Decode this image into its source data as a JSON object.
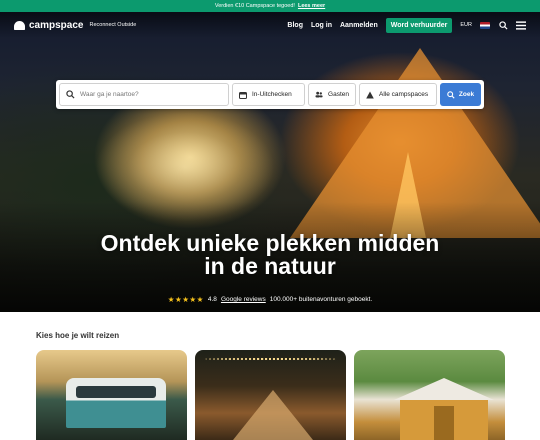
{
  "promo": {
    "text": "Verdien €10 Campspace tegoed!",
    "link": "Lees meer"
  },
  "nav": {
    "brand": "campspace",
    "tagline": "Reconnect Outside",
    "links": [
      "Blog",
      "Log in",
      "Aanmelden"
    ],
    "host_button": "Word verhuurder",
    "language": "EUR",
    "flag": "netherlands-flag",
    "icons": [
      "search-icon",
      "menu-icon"
    ]
  },
  "search": {
    "placeholder": "Waar ga je naartoe?",
    "dates_label": "In-Uitchecken",
    "guests_label": "Gasten",
    "type_label": "Alle campspaces",
    "button_label": "Zoek"
  },
  "hero": {
    "headline_line1": "Ontdek unieke plekken midden",
    "headline_line2": "in de natuur",
    "stars": "★★★★★",
    "rating": "4.8",
    "reviews_link": "Google reviews",
    "bookings_text": "100.000+ buitenavonturen geboekt."
  },
  "travel": {
    "title": "Kies hoe je wilt reizen"
  },
  "colors": {
    "brand_green": "#0c9a6e",
    "search_blue": "#3b7bd5",
    "star_yellow": "#f5c11c"
  }
}
